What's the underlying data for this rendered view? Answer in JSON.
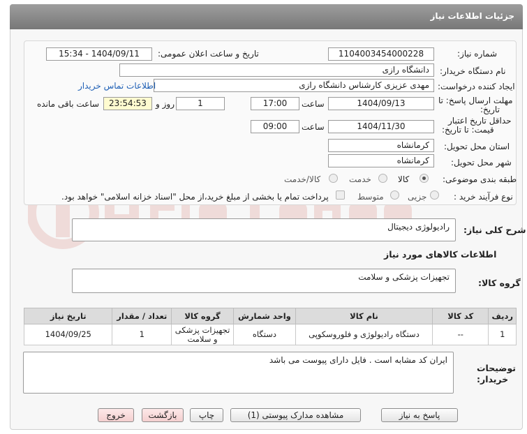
{
  "header": {
    "title": "جزئیات اطلاعات نیاز"
  },
  "form": {
    "need_number_label": "شماره نیاز:",
    "need_number": "1104003454000228",
    "announce_label": "تاریخ و ساعت اعلان عمومی:",
    "announce_value": "1404/09/11 - 15:34",
    "buyer_org_label": "نام دستگاه خریدار:",
    "buyer_org": "دانشگاه رازی",
    "creator_label": "ایجاد کننده درخواست:",
    "creator": "مهدی عزیزی کارشناس دانشگاه رازی",
    "contact_link": "اطلاعات تماس خریدار",
    "deadline_label_1": "مهلت ارسال پاسخ: تا",
    "deadline_label_2": "تاریخ:",
    "deadline_date": "1404/09/13",
    "time_label": "ساعت",
    "deadline_time": "17:00",
    "days_value": "1",
    "days_label": "روز و",
    "remaining_time": "23:54:53",
    "remaining_label": "ساعت باقی مانده",
    "validity_label_1": "حداقل تاریخ اعتبار",
    "validity_label_2": "قیمت: تا تاریخ:",
    "validity_date": "1404/11/30",
    "validity_time": "09:00",
    "province_label": "استان محل تحویل:",
    "province": "کرمانشاه",
    "city_label": "شهر محل تحویل:",
    "city": "کرمانشاه",
    "category_label": "طبقه بندی موضوعی:",
    "category_options": [
      "کالا",
      "خدمت",
      "کالا/خدمت"
    ],
    "category_selected": "کالا",
    "process_label": "نوع فرآیند خرید :",
    "process_options": [
      "جزیی",
      "متوسط"
    ],
    "process_note": "پرداخت تمام یا بخشی از مبلغ خرید،از محل \"اسناد خزانه اسلامی\" خواهد بود."
  },
  "description": {
    "label": "شرح کلی نیاز:",
    "value": "رادیولوژی دیجیتال"
  },
  "goods": {
    "section_title": "اطلاعات کالاهای مورد نیاز",
    "group_label": "گروه کالا:",
    "group_value": "تجهیزات پزشکی و سلامت",
    "columns": [
      "ردیف",
      "کد کالا",
      "نام کالا",
      "واحد شمارش",
      "گروه کالا",
      "تعداد / مقدار",
      "تاریخ نیاز"
    ],
    "rows": [
      [
        "1",
        "--",
        "دستگاه رادیولوژی و فلوروسکوپی",
        "دستگاه",
        "تجهیزات پزشکی و سلامت",
        "1",
        "1404/09/25"
      ]
    ]
  },
  "buyer_notes": {
    "label_1": "توضیحات",
    "label_2": "خریدار:",
    "value": "ایران کد مشابه است . فایل دارای پیوست می باشد"
  },
  "buttons": {
    "reply": "پاسخ به نیاز",
    "attachments": "مشاهده مدارک پیوستی (1)",
    "print": "چاپ",
    "back": "بازگشت",
    "exit": "خروج"
  },
  "colors": {
    "header": "#8a8a8a",
    "link": "#1e5fb5",
    "remaining_bg": "#fffbd0",
    "pink_button": "#f4cfcf"
  }
}
